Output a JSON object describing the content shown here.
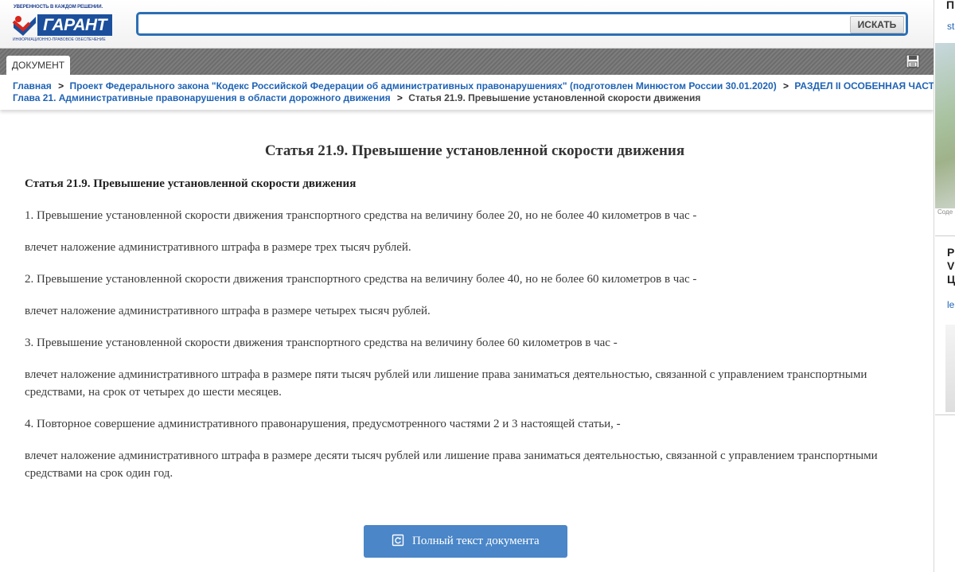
{
  "header": {
    "logo_tagline": "УВЕРЕННОСТЬ В КАЖДОМ РЕШЕНИИ.",
    "logo_brand": "ГАРАНТ",
    "logo_subtitle": "ИНФОРМАЦИОННО-ПРАВОВОЕ ОБЕСПЕЧЕНИЕ",
    "search_value": "",
    "search_button": "ИСКАТЬ"
  },
  "tab": {
    "label": "ДОКУМЕНТ"
  },
  "icons": {
    "save": "save-icon",
    "full_text": "document-refresh-icon"
  },
  "colors": {
    "link": "#1f63b5",
    "button": "#4a86c8",
    "search_border": "#2c6fb3"
  },
  "breadcrumbs": [
    {
      "label": "Главная"
    },
    {
      "label": "Проект Федерального закона \"Кодекс Российской Федерации об административных правонарушениях\" (подготовлен Минюстом России 30.01.2020)"
    },
    {
      "label": "РАЗДЕЛ II ОСОБЕННАЯ ЧАСТЬ"
    },
    {
      "label": "Глава 21.  Административные правонарушения в области дорожного движения"
    },
    {
      "label": "Статья 21.9. Превышение установленной скорости движения"
    }
  ],
  "article": {
    "title": "Статья 21.9. Превышение установленной скорости движения",
    "subtitle": "Статья 21.9. Превышение установленной скорости движения",
    "paragraphs": [
      "1. Превышение установленной скорости движения транспортного средства на величину более 20, но не более 40 километров в час -",
      "влечет наложение административного штрафа в размере трех тысяч рублей.",
      "2. Превышение установленной скорости движения транспортного средства на величину более 40, но не более 60 километров в час -",
      "влечет наложение административного штрафа в размере четырех тысяч рублей.",
      "3. Превышение установленной скорости движения транспортного средства на величину более 60 километров в час -",
      "влечет наложение административного штрафа в размере пяти тысяч рублей или лишение права заниматься деятельностью, связанной с управлением транспортными средствами, на срок от четырех до шести месяцев.",
      "4. Повторное совершение административного правонарушения, предусмотренного частями 2 и 3 настоящей статьи, -",
      "влечет наложение административного штрафа в размере десяти тысяч рублей или лишение права заниматься деятельностью, связанной с управлением транспортными средствами на срок один год."
    ],
    "full_text_button": "Полный текст документа"
  },
  "sidebar": {
    "title_fragment": "П",
    "link_fragment": "st",
    "caption_fragment": "Соде",
    "box_title_fragment": "P V Ц",
    "box_link_fragment": "le"
  }
}
